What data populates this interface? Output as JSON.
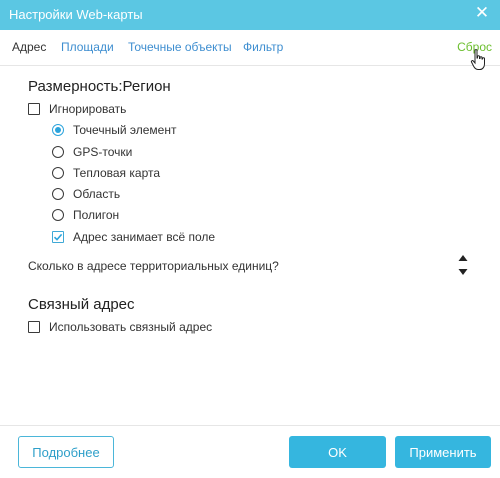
{
  "window": {
    "title": "Настройки Web-карты",
    "title_bar_color": "#5bc7e3",
    "close_icon": "close-icon"
  },
  "tabs": [
    {
      "label": "Адрес",
      "active": true
    },
    {
      "label": "Площади",
      "active": false
    },
    {
      "label": "Точечные объекты",
      "active": false
    },
    {
      "label": "Фильтр",
      "active": false
    }
  ],
  "reset_label": "Сброс",
  "section_dimension": {
    "title": "Размерность:Регион",
    "ignore_label": "Игнорировать",
    "ignore_checked": false,
    "options": [
      {
        "label": "Точечный элемент",
        "selected": true
      },
      {
        "label": "GPS-точки",
        "selected": false
      },
      {
        "label": "Тепловая карта",
        "selected": false
      },
      {
        "label": "Область",
        "selected": false
      },
      {
        "label": "Полигон",
        "selected": false
      }
    ],
    "full_field_label": "Адрес занимает всё поле",
    "full_field_checked": true
  },
  "question": {
    "label": "Сколько в адресе территориальных единиц?",
    "stepper_icon": "up-down-arrows-icon"
  },
  "section_linked": {
    "title": "Связный адрес",
    "use_linked_label": "Использовать связный адрес",
    "use_linked_checked": false
  },
  "footer": {
    "details_label": "Подробнее",
    "ok_label": "OK",
    "apply_label": "Применить"
  },
  "colors": {
    "accent": "#35b6df",
    "link": "#3e8ed0",
    "reset": "#6cbf2f"
  }
}
